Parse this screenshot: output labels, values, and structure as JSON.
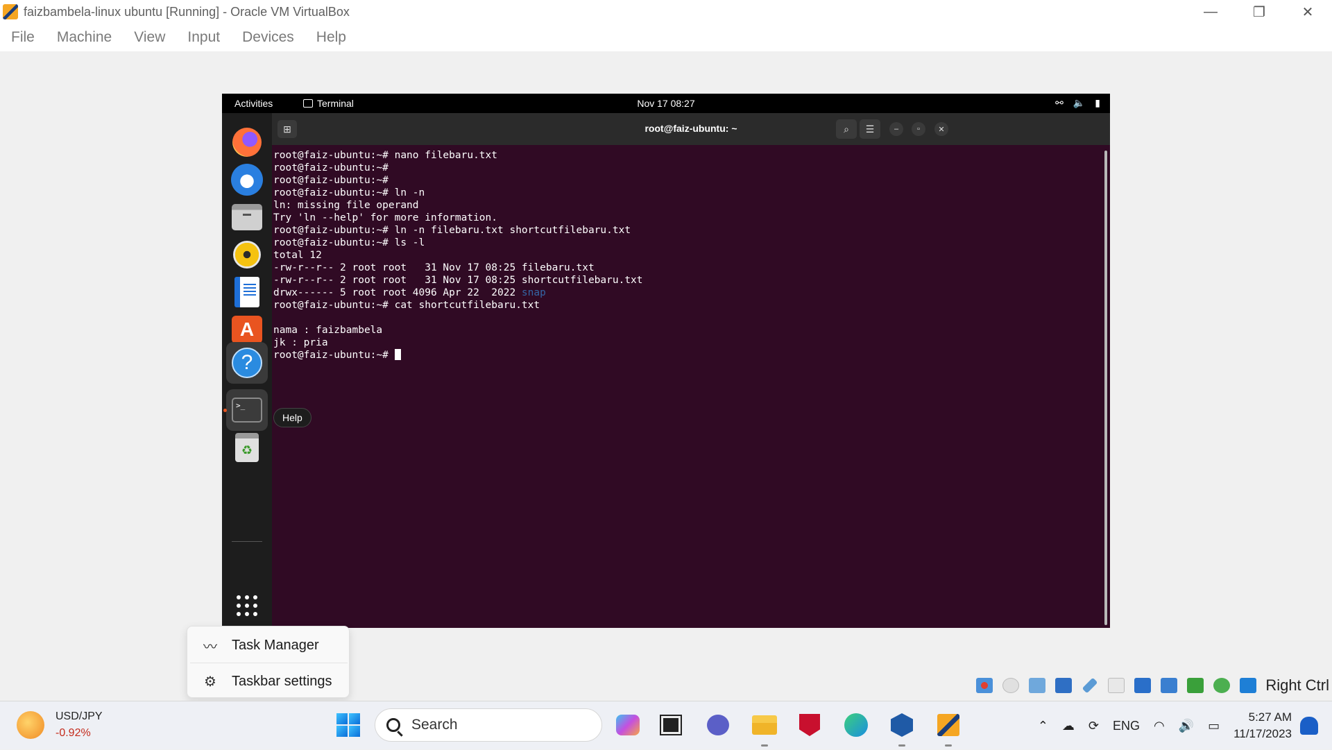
{
  "host_window": {
    "title": "faizbambela-linux ubuntu [Running] - Oracle VM VirtualBox",
    "controls": [
      "—",
      "❐",
      "✕"
    ]
  },
  "vbox_menu": [
    "File",
    "Machine",
    "View",
    "Input",
    "Devices",
    "Help"
  ],
  "gnome_topbar": {
    "activities": "Activities",
    "app_name": "Terminal",
    "clock": "Nov 17  08:27"
  },
  "dock": {
    "tooltip": "Help",
    "apps": [
      "firefox-icon",
      "thunderbird-icon",
      "files-icon",
      "rhythmbox-icon",
      "libreoffice-writer-icon",
      "app-center-icon",
      "help-icon",
      "terminal-icon",
      "trash-icon",
      "show-apps-icon"
    ]
  },
  "terminal": {
    "title": "root@faiz-ubuntu: ~",
    "lines": [
      "root@faiz-ubuntu:~# nano filebaru.txt",
      "root@faiz-ubuntu:~#",
      "root@faiz-ubuntu:~#",
      "root@faiz-ubuntu:~# ln -n",
      "ln: missing file operand",
      "Try 'ln --help' for more information.",
      "root@faiz-ubuntu:~# ln -n filebaru.txt shortcutfilebaru.txt",
      "root@faiz-ubuntu:~# ls -l",
      "total 12",
      "-rw-r--r-- 2 root root   31 Nov 17 08:25 filebaru.txt",
      "-rw-r--r-- 2 root root   31 Nov 17 08:25 shortcutfilebaru.txt",
      "drwx------ 5 root root 4096 Apr 22  2022 ",
      "root@faiz-ubuntu:~# cat shortcutfilebaru.txt",
      "",
      "nama : faizbambela",
      "jk : pria",
      "root@faiz-ubuntu:~# "
    ],
    "snap_dir": "snap"
  },
  "context_menu": {
    "task_manager": "Task Manager",
    "taskbar_settings": "Taskbar settings"
  },
  "vbox_status": {
    "host_key": "Right Ctrl"
  },
  "taskbar": {
    "ticker_name": "USD/JPY",
    "ticker_change": "-0.92%",
    "search_placeholder": "Search",
    "lang": "ENG",
    "time": "5:27 AM",
    "date": "11/17/2023"
  },
  "colors": {
    "terminal_bg": "#300a24",
    "ubuntu_orange": "#e95420",
    "ticker_negative": "#c42b1c"
  }
}
